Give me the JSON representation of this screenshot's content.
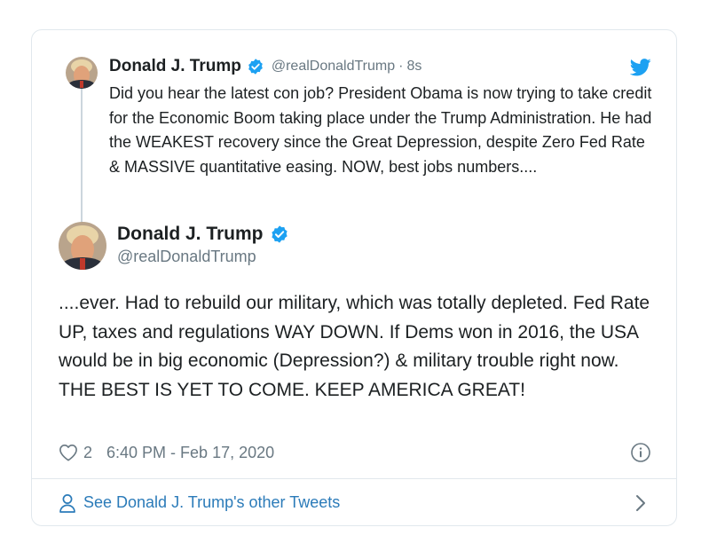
{
  "tweet_parent": {
    "name": "Donald J. Trump",
    "handle": "@realDonaldTrump",
    "separator": "·",
    "time": "8s",
    "text": "Did you hear the latest con job? President Obama is now trying to take credit for the Economic Boom taking place under the Trump Administration. He had the WEAKEST recovery since the Great Depression, despite Zero Fed Rate & MASSIVE quantitative easing. NOW, best jobs numbers...."
  },
  "tweet_main": {
    "name": "Donald J. Trump",
    "handle": "@realDonaldTrump",
    "text": "....ever. Had to rebuild our military, which was totally depleted. Fed Rate UP, taxes and regulations WAY DOWN. If Dems won in 2016, the USA would be in big economic (Depression?) & military trouble right now. THE BEST IS YET TO COME. KEEP AMERICA GREAT!",
    "likes": "2",
    "timestamp": "6:40 PM - Feb 17, 2020"
  },
  "footer": {
    "link_text": "See Donald J. Trump's other Tweets"
  },
  "icons": {
    "verified": "verified-badge-icon",
    "bird": "twitter-bird-icon",
    "heart": "heart-icon",
    "info": "info-icon",
    "person": "person-icon",
    "chevron": "chevron-right-icon"
  },
  "colors": {
    "verified_blue": "#1da1f2",
    "link_blue": "#2b7bb9",
    "secondary_text": "#697882",
    "border": "#e1e8ed"
  }
}
